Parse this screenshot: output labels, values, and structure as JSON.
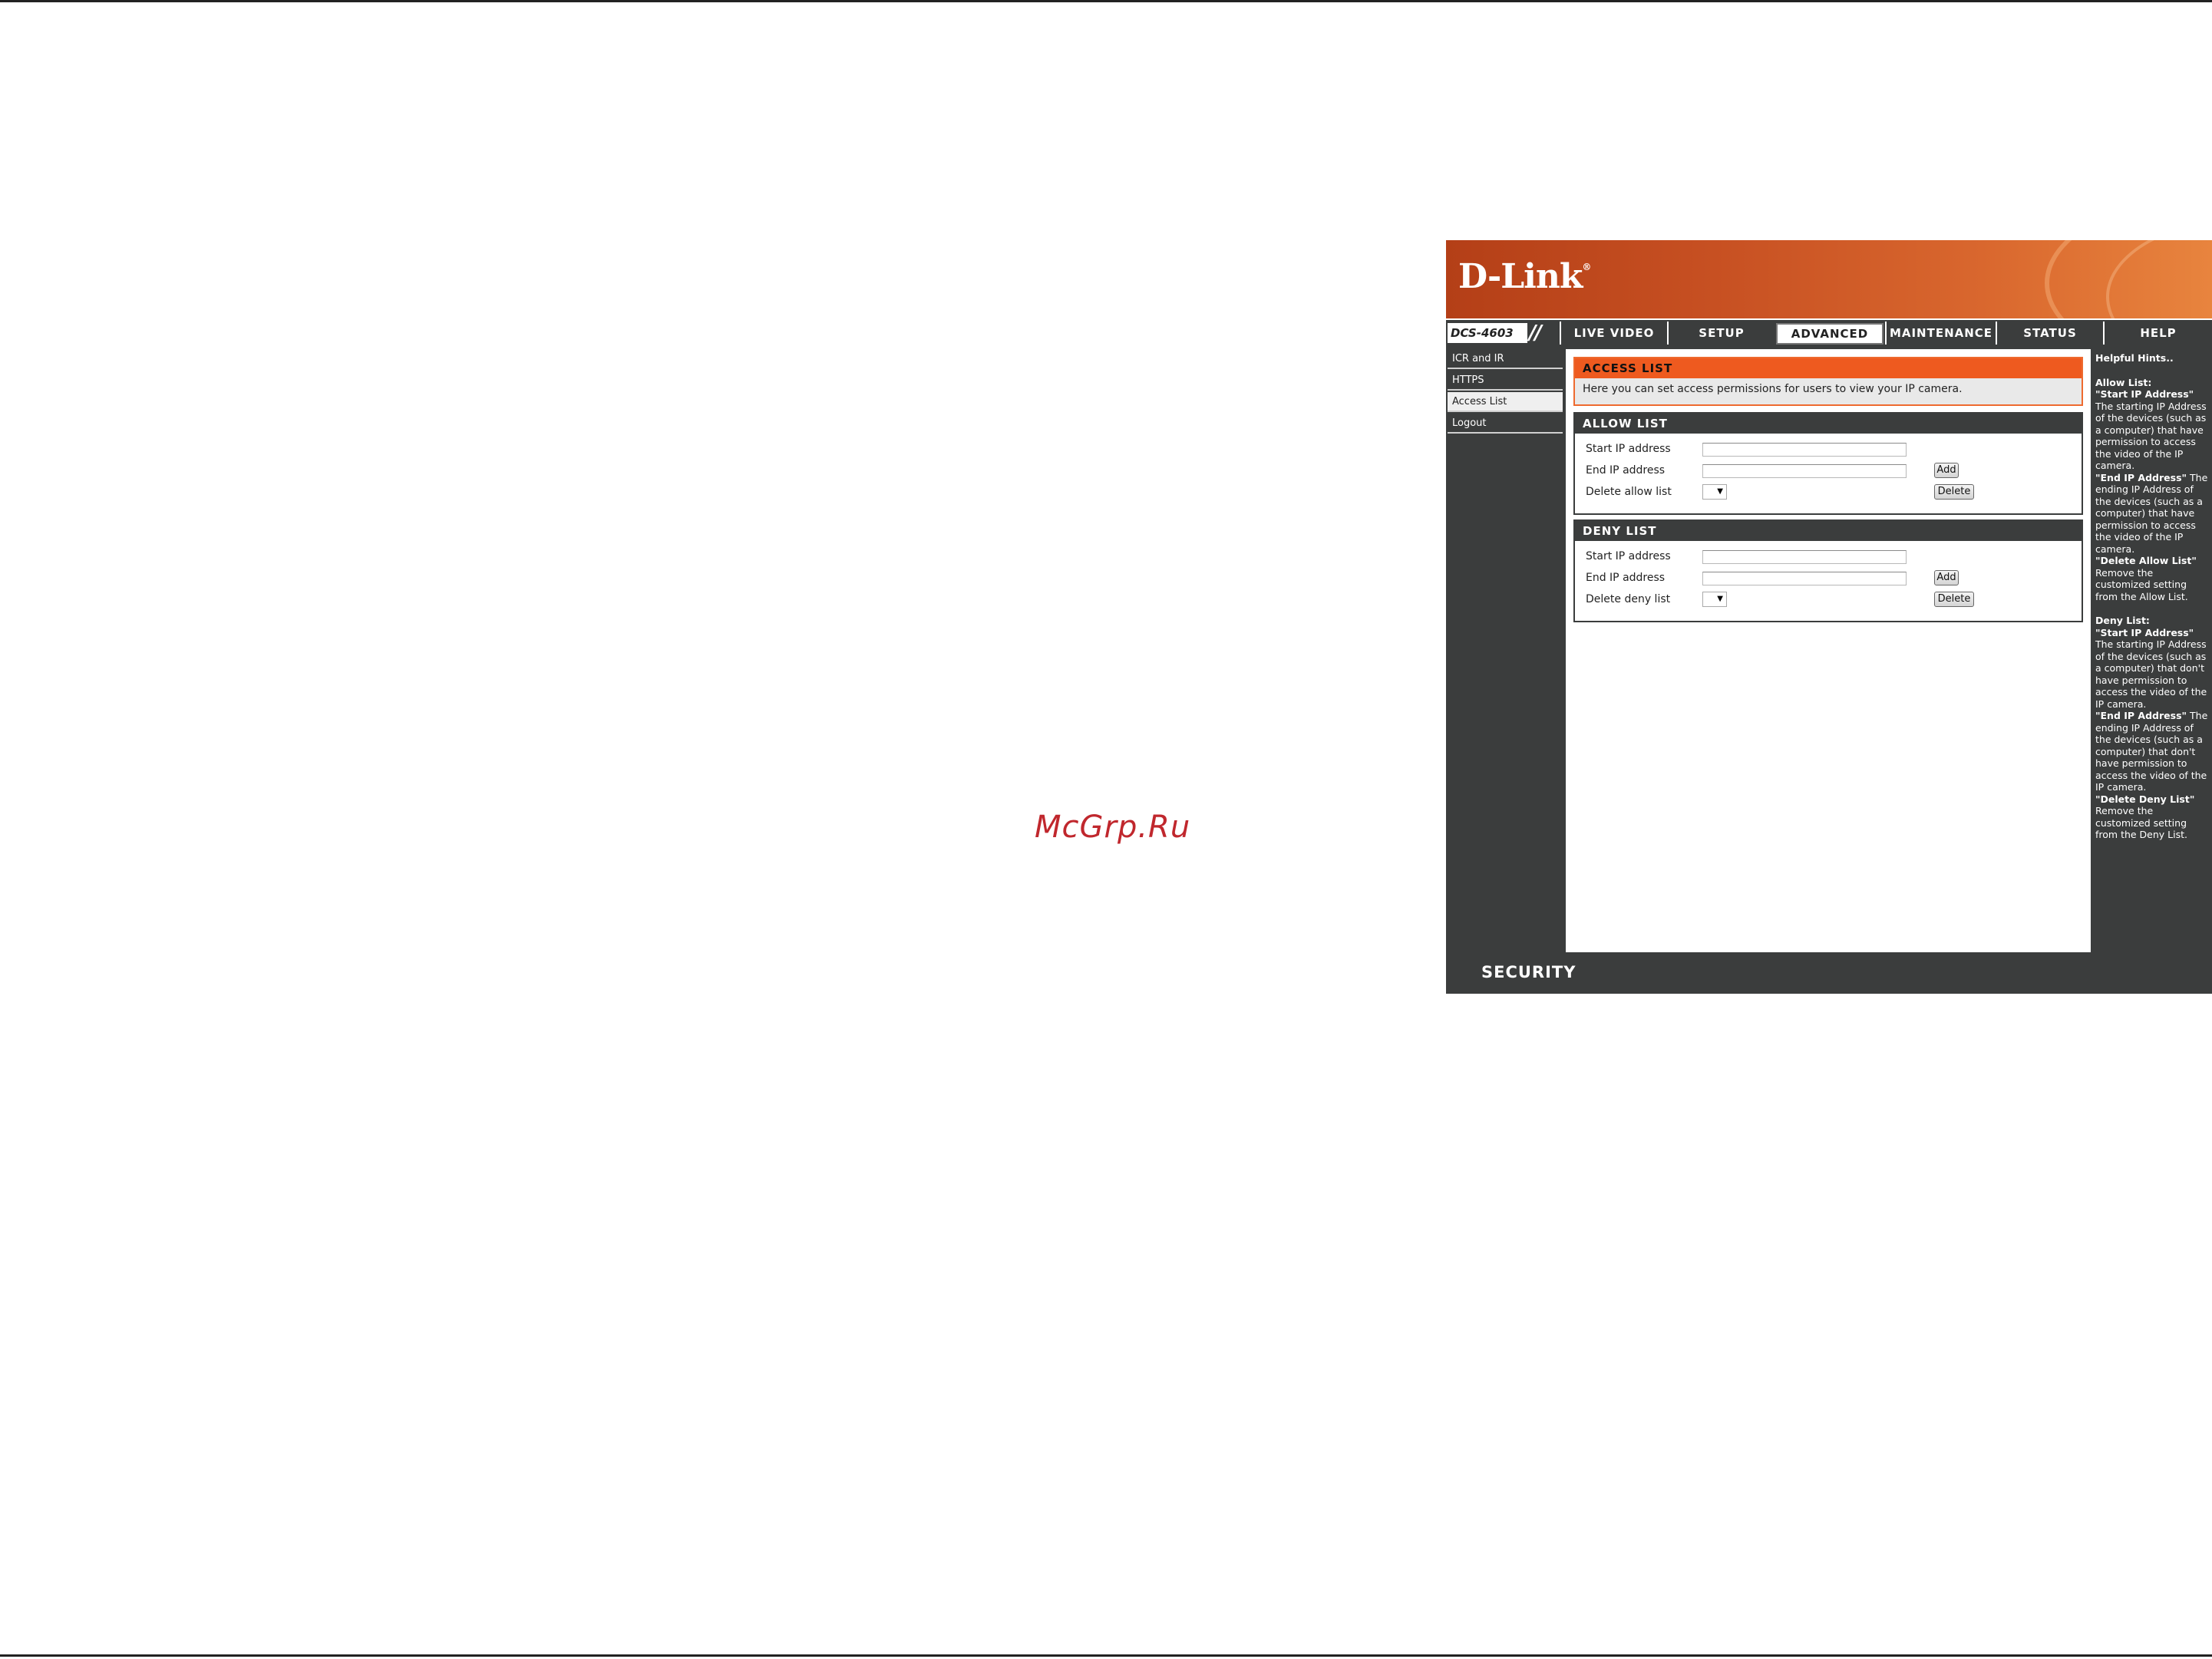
{
  "watermark": "McGrp.Ru",
  "brand": {
    "logo": "D-Link",
    "trademark": "®",
    "model": "DCS-4603",
    "model_slash": "//"
  },
  "tabs": [
    {
      "label": "LIVE VIDEO",
      "active": false
    },
    {
      "label": "SETUP",
      "active": false
    },
    {
      "label": "ADVANCED",
      "active": true
    },
    {
      "label": "MAINTENANCE",
      "active": false
    },
    {
      "label": "STATUS",
      "active": false
    },
    {
      "label": "HELP",
      "active": false
    }
  ],
  "sidebar": {
    "items": [
      {
        "label": "ICR and IR",
        "active": false
      },
      {
        "label": "HTTPS",
        "active": false
      },
      {
        "label": "Access List",
        "active": true
      },
      {
        "label": "Logout",
        "active": false
      }
    ]
  },
  "access_list": {
    "title": "ACCESS LIST",
    "description": "Here you can set access permissions for users to view your IP camera."
  },
  "allow_list": {
    "title": "ALLOW LIST",
    "start_label": "Start IP address",
    "start_value": "",
    "end_label": "End IP address",
    "end_value": "",
    "delete_label": "Delete allow list",
    "delete_selected": "",
    "add_button": "Add",
    "delete_button": "Delete"
  },
  "deny_list": {
    "title": "DENY LIST",
    "start_label": "Start IP address",
    "start_value": "",
    "end_label": "End IP address",
    "end_value": "",
    "delete_label": "Delete deny list",
    "delete_selected": "",
    "add_button": "Add",
    "delete_button": "Delete"
  },
  "help": {
    "title": "Helpful Hints..",
    "allow_heading": "Allow List:",
    "allow_start_term": "\"Start IP Address\"",
    "allow_start_text": "The starting IP Address of the devices (such as a computer) that have permission to access the video of the IP camera.",
    "allow_end_term": "\"End IP Address\"",
    "allow_end_text": "The ending IP Address of the devices (such as a computer) that have permission to access the video of the IP camera.",
    "allow_delete_term": "\"Delete Allow List\"",
    "allow_delete_text": "Remove the customized setting from the Allow List.",
    "deny_heading": "Deny List:",
    "deny_start_term": "\"Start IP Address\"",
    "deny_start_text": "The starting IP Address of the devices (such as a computer) that don't have permission to access the video of the IP camera.",
    "deny_end_term": "\"End IP Address\"",
    "deny_end_text": "The ending IP Address of the devices (such as a computer) that don't have permission to access the video of the IP camera.",
    "deny_delete_term": "\"Delete Deny List\"",
    "deny_delete_text": "Remove the customized setting from the Deny List."
  },
  "footer": {
    "label": "SECURITY"
  },
  "colors": {
    "accent": "#ee5a1f",
    "dark": "#3b3d3d",
    "banner": "#c75022"
  },
  "icons": {
    "dropdown": "chevron-down-icon"
  }
}
